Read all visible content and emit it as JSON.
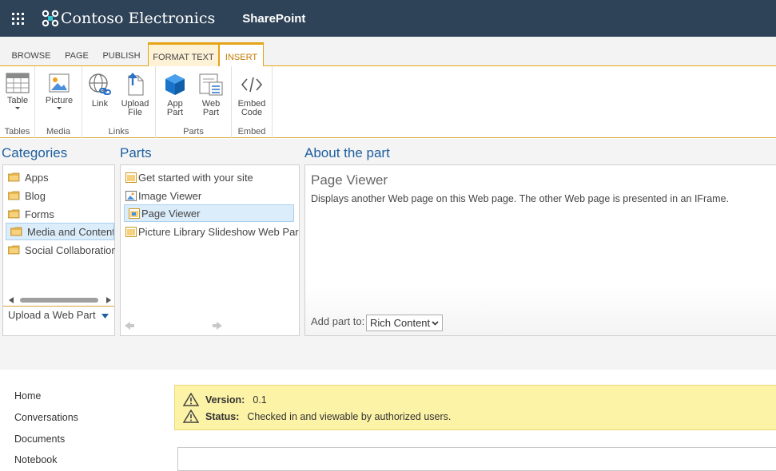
{
  "suitebar": {
    "org_name": "Contoso Electronics",
    "app_name": "SharePoint",
    "bg_color": "#2f4358"
  },
  "ribbon_tabs": [
    {
      "label": "BROWSE"
    },
    {
      "label": "PAGE"
    },
    {
      "label": "PUBLISH"
    },
    {
      "label": "FORMAT TEXT"
    },
    {
      "label": "INSERT",
      "active": true
    }
  ],
  "ribbon_groups": {
    "tables": {
      "label": "Tables",
      "buttons": [
        "Table"
      ]
    },
    "media": {
      "label": "Media",
      "buttons": [
        "Picture"
      ]
    },
    "links": {
      "label": "Links",
      "buttons": [
        "Link",
        "Upload File"
      ]
    },
    "parts": {
      "label": "Parts",
      "buttons": [
        "App Part",
        "Web Part"
      ]
    },
    "embed": {
      "label": "Embed",
      "buttons": [
        "Embed Code"
      ]
    }
  },
  "ribbon_buttons": {
    "table_l1": "Table",
    "picture_l1": "Picture",
    "link_l1": "Link",
    "upload_l1": "Upload",
    "upload_l2": "File",
    "app_l1": "App",
    "app_l2": "Part",
    "web_l1": "Web",
    "web_l2": "Part",
    "embed_l1": "Embed",
    "embed_l2": "Code"
  },
  "categories": {
    "title": "Categories",
    "items": [
      "Apps",
      "Blog",
      "Forms",
      "Media and Content",
      "Social Collaboration"
    ],
    "selected": "Media and Content",
    "upload_link": "Upload a Web Part"
  },
  "parts": {
    "title": "Parts",
    "items": [
      "Get started with your site",
      "Image Viewer",
      "Page Viewer",
      "Picture Library Slideshow Web Par"
    ],
    "selected": "Page Viewer"
  },
  "about": {
    "title": "About the part",
    "part_name": "Page Viewer",
    "description": "Displays another Web page on this Web page. The other Web page is presented in an IFrame.",
    "add_to_label": "Add part to:",
    "add_to_value": "Rich Content"
  },
  "quick_launch": [
    "Home",
    "Conversations",
    "Documents",
    "Notebook"
  ],
  "status": {
    "version_label": "Version:",
    "version_value": "0.1",
    "status_label": "Status:",
    "status_value": "Checked in and viewable by authorized users."
  },
  "colors": {
    "accent_orange": "#e6a317",
    "title_blue": "#1f5f9f",
    "status_yellow": "#fcf3a6"
  }
}
